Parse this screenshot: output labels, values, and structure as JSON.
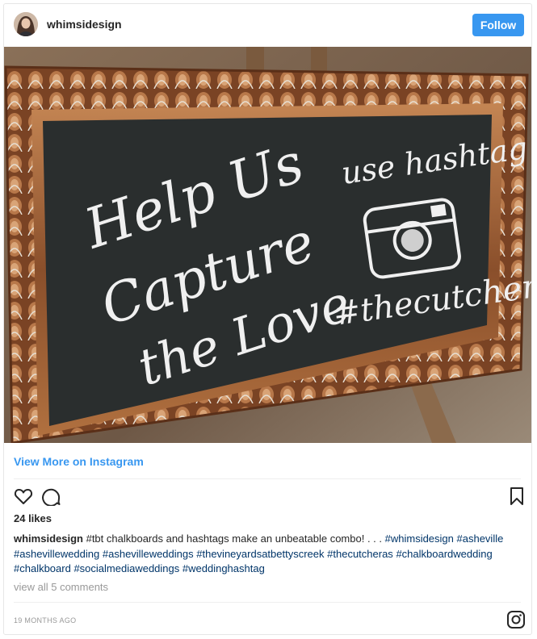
{
  "header": {
    "username": "whimsidesign",
    "follow_label": "Follow"
  },
  "photo": {
    "sign_left": [
      "Help Us",
      "Capture",
      "the Love"
    ],
    "sign_right_top": "use hashtag",
    "sign_hashtag": "#thecutcheras"
  },
  "links": {
    "view_more": "View More on Instagram"
  },
  "actions": {
    "like_icon": "heart-icon",
    "comment_icon": "comment-icon",
    "save_icon": "bookmark-icon"
  },
  "post": {
    "likes": "24 likes",
    "caption_user": "whimsidesign",
    "caption_text": "#tbt chalkboards and hashtags make an unbeatable combo! . . .",
    "hashtags": [
      "#whimsidesign",
      "#asheville",
      "#ashevillewedding",
      "#ashevilleweddings",
      "#thevineyardsatbettyscreek",
      "#thecutcheras",
      "#chalkboardwedding",
      "#chalkboard",
      "#socialmediaweddings",
      "#weddinghashtag"
    ],
    "view_comments": "view all 5 comments",
    "timestamp": "19 MONTHS AGO"
  },
  "colors": {
    "accent": "#3897f0",
    "hashtag": "#003569",
    "muted": "#999999",
    "chalkboard": "#2a2e2e",
    "frame_copper": "#a4643a"
  }
}
